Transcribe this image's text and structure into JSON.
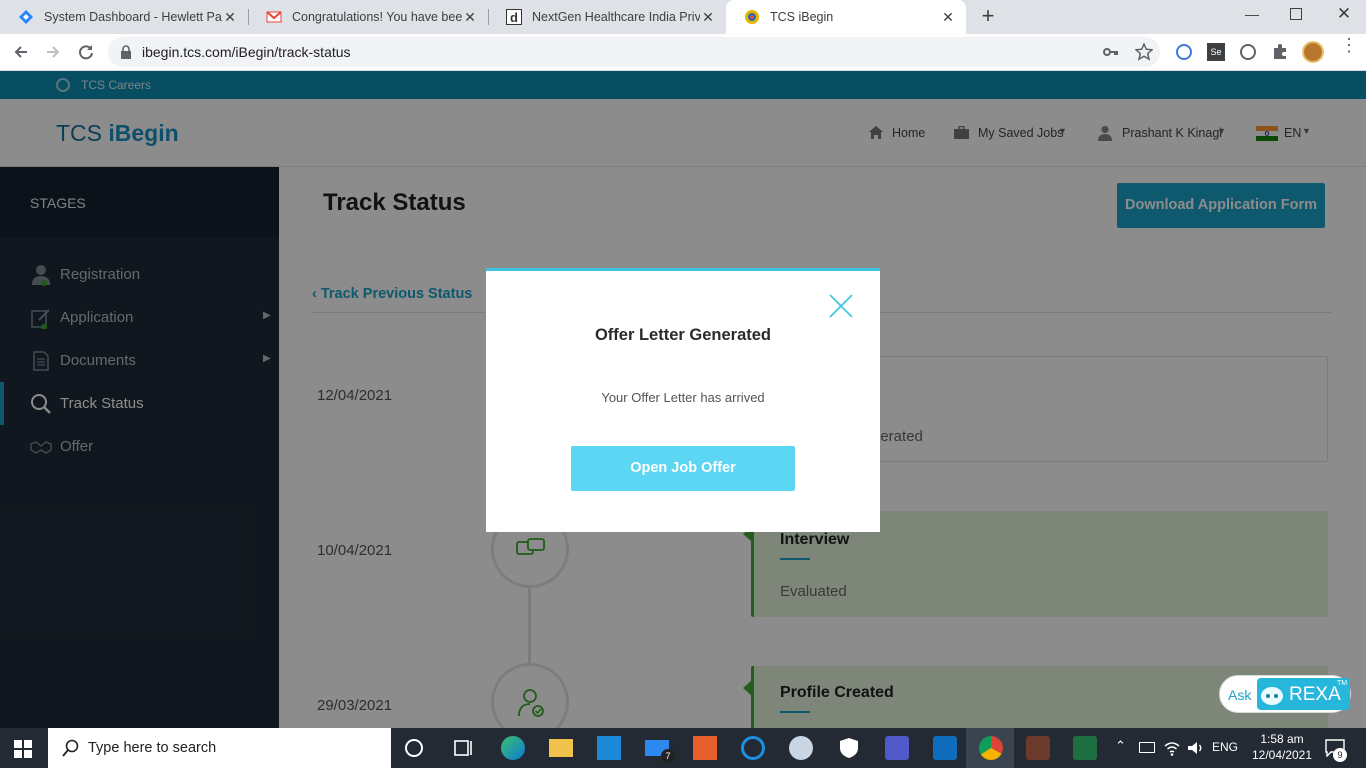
{
  "browser": {
    "tabs": [
      {
        "title": "System Dashboard - Hewlett Pack",
        "icon": "jira-icon"
      },
      {
        "title": "Congratulations! You have been s",
        "icon": "gmail-icon"
      },
      {
        "title": "NextGen Healthcare India Private",
        "icon": "d-icon"
      },
      {
        "title": "TCS iBegin",
        "icon": "tcs-icon"
      }
    ],
    "url": "ibegin.tcs.com/iBegin/track-status"
  },
  "site": {
    "careers_label": "TCS Careers",
    "logo_prefix": "TCS ",
    "logo_brand": "iBegin",
    "nav": {
      "home": "Home",
      "saved_jobs": "My Saved Jobs",
      "user": "Prashant K Kinagi",
      "lang": "EN"
    }
  },
  "sidebar": {
    "heading": "STAGES",
    "items": [
      {
        "label": "Registration"
      },
      {
        "label": "Application"
      },
      {
        "label": "Documents"
      },
      {
        "label": "Track Status"
      },
      {
        "label": "Offer"
      }
    ]
  },
  "main": {
    "title": "Track Status",
    "download_button": "Download Application Form",
    "previous_link": "‹ Track Previous Status",
    "timeline": [
      {
        "date": "12/04/2021",
        "title": "",
        "status": "nerated"
      },
      {
        "date": "10/04/2021",
        "title": "Interview",
        "status": "Evaluated"
      },
      {
        "date": "29/03/2021",
        "title": "Profile Created",
        "status": ""
      }
    ]
  },
  "modal": {
    "title": "Offer Letter Generated",
    "message": "Your Offer Letter has arrived",
    "button": "Open Job Offer"
  },
  "chatbot": {
    "ask": "Ask",
    "brand": "REXA",
    "tm": "TM"
  },
  "taskbar": {
    "search_placeholder": "Type here to search",
    "lang": "ENG",
    "time": "1:58 am",
    "date": "12/04/2021",
    "notifications": "9",
    "mail_badge": "7"
  },
  "colors": {
    "accent": "#1aa3c8",
    "sidebar": "#1f2b38",
    "modal_button": "#5dd6f4"
  }
}
